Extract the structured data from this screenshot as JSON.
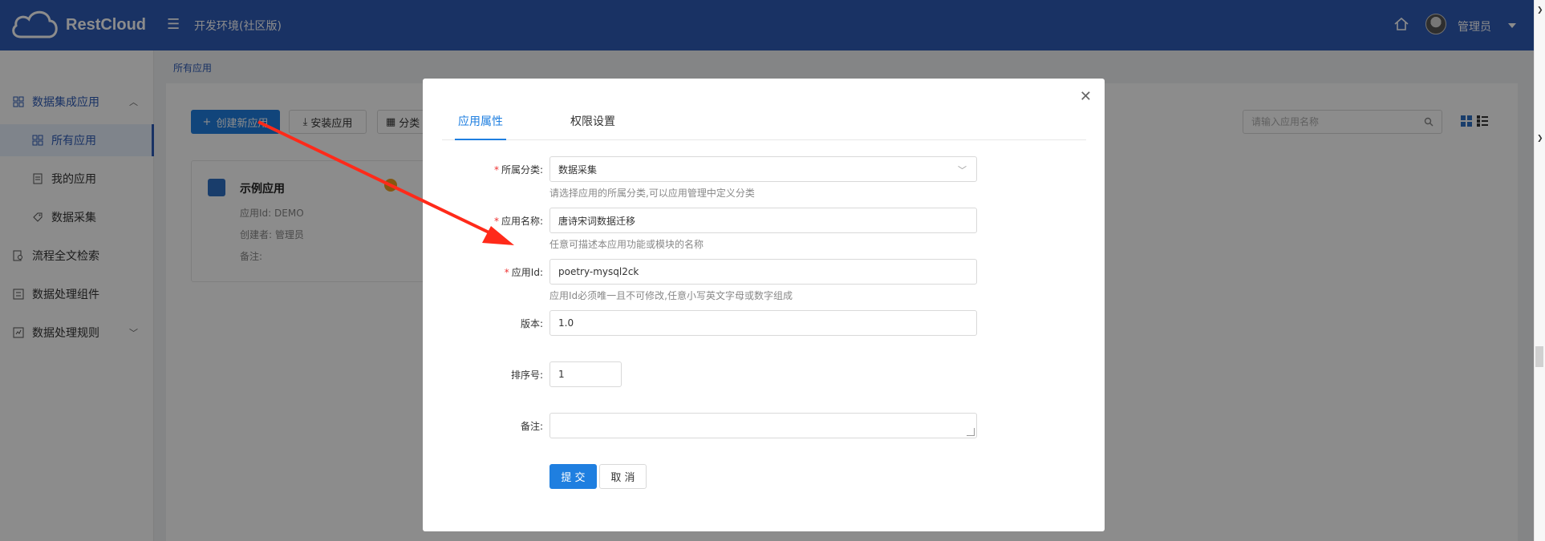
{
  "header": {
    "brand": "RestCloud",
    "env_title": "开发环境(社区版)",
    "user_name": "管理员",
    "bg_color": "#2f5bb7"
  },
  "sidebar": {
    "items": [
      {
        "label": "数据集成应用",
        "icon": "grid-icon"
      },
      {
        "label": "所有应用",
        "icon": "grid-icon"
      },
      {
        "label": "我的应用",
        "icon": "doc-icon"
      },
      {
        "label": "数据采集",
        "icon": "tag-icon"
      },
      {
        "label": "流程全文检索",
        "icon": "search-doc-icon"
      },
      {
        "label": "数据处理组件",
        "icon": "list-icon"
      },
      {
        "label": "数据处理规则",
        "icon": "rule-icon"
      }
    ]
  },
  "breadcrumb": "所有应用",
  "toolbar": {
    "create_label": "创建新应用",
    "install_label": "安装应用",
    "category_label": "分类",
    "search_placeholder": "请输入应用名称"
  },
  "app_card": {
    "title": "示例应用",
    "app_id": "应用Id: DEMO",
    "creator": "创建者: 管理员",
    "remark": "备注:"
  },
  "modal": {
    "tabs": [
      "应用属性",
      "权限设置"
    ],
    "fields": {
      "category_label": "所属分类:",
      "category_value": "数据采集",
      "category_hint": "请选择应用的所属分类,可以应用管理中定义分类",
      "name_label": "应用名称:",
      "name_value": "唐诗宋词数据迁移",
      "name_hint": "任意可描述本应用功能或模块的名称",
      "id_label": "应用Id:",
      "id_value": "poetry-mysql2ck",
      "id_hint": "应用Id必须唯一且不可修改,任意小写英文字母或数字组成",
      "version_label": "版本:",
      "version_value": "1.0",
      "order_label": "排序号:",
      "order_value": "1",
      "remark_label": "备注:"
    },
    "submit_label": "提 交",
    "cancel_label": "取 消"
  },
  "colors": {
    "primary": "#1f7fe0",
    "required": "#e33333",
    "annotation_arrow": "#ff2a1a"
  }
}
